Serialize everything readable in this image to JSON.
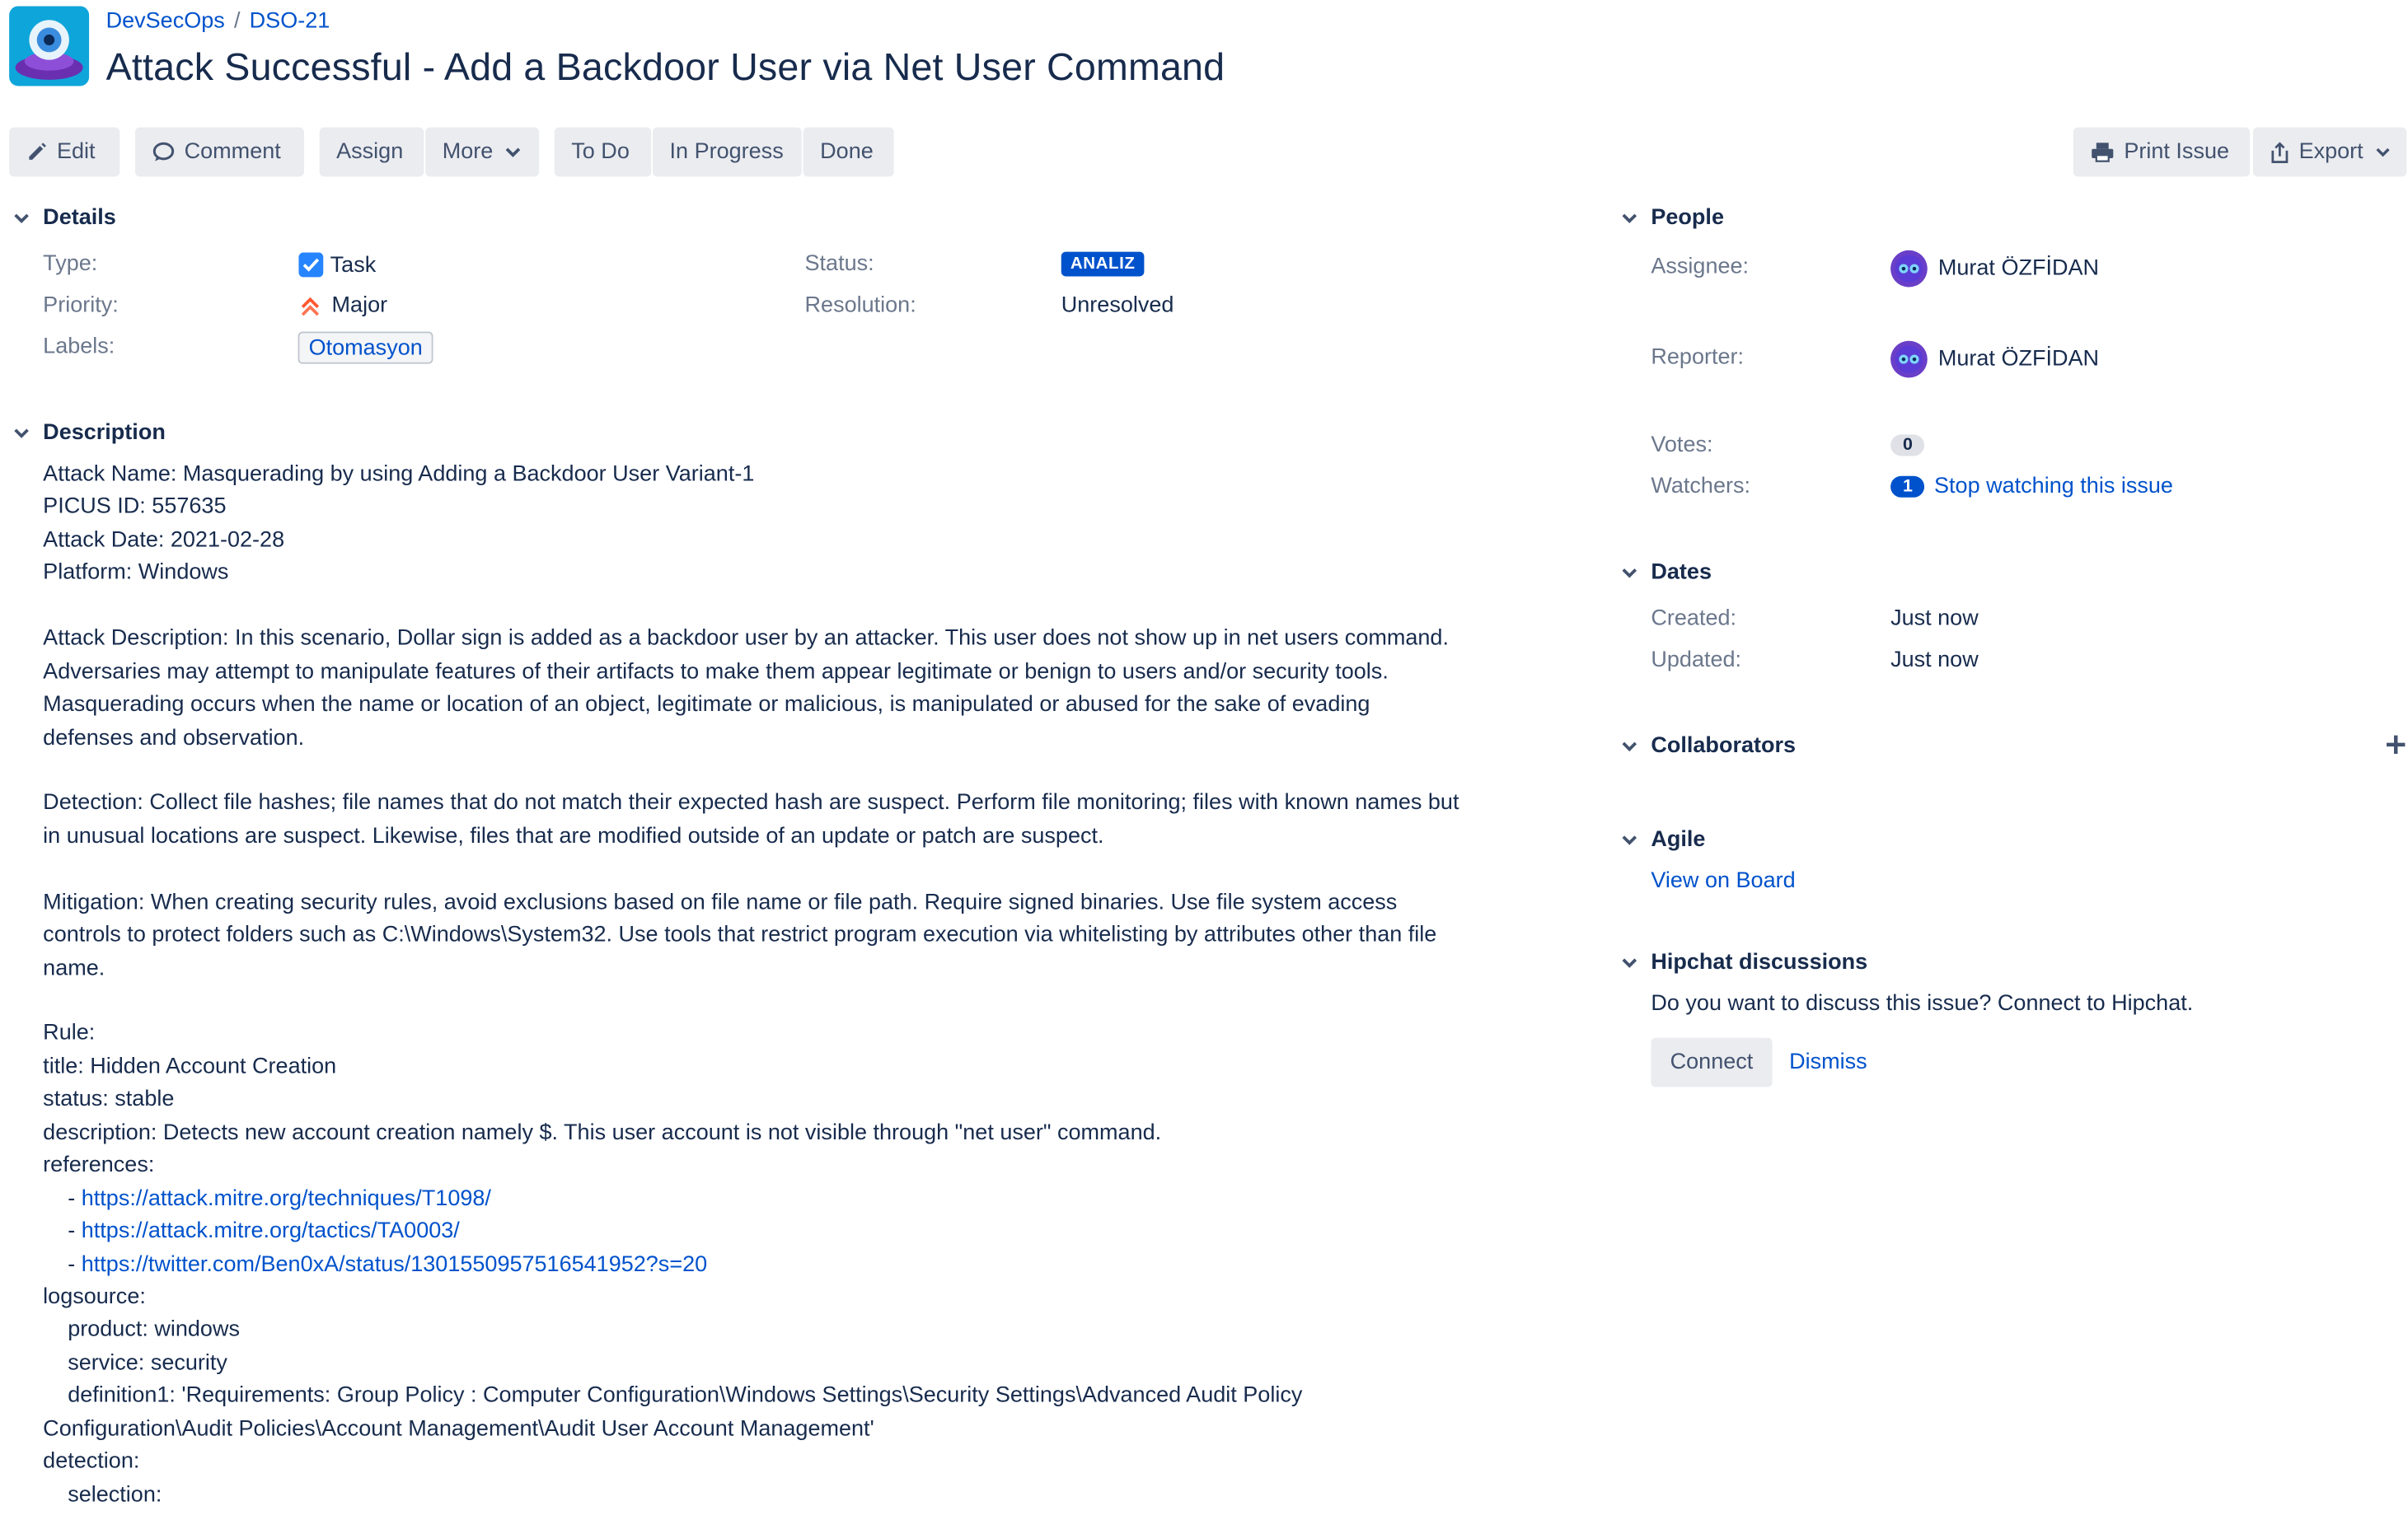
{
  "header": {
    "project": "DevSecOps",
    "separator": "/",
    "issue_key": "DSO-21",
    "title": "Attack Successful - Add a Backdoor User via Net User Command"
  },
  "toolbar": {
    "edit": "Edit",
    "comment": "Comment",
    "assign": "Assign",
    "more": "More",
    "todo": "To Do",
    "in_progress": "In Progress",
    "done": "Done",
    "print": "Print Issue",
    "export": "Export"
  },
  "details": {
    "heading": "Details",
    "type_label": "Type:",
    "type_value": "Task",
    "priority_label": "Priority:",
    "priority_value": "Major",
    "labels_label": "Labels:",
    "labels_value": "Otomasyon",
    "status_label": "Status:",
    "status_value": "ANALIZ",
    "resolution_label": "Resolution:",
    "resolution_value": "Unresolved"
  },
  "description": {
    "heading": "Description",
    "lines": [
      {
        "text": "Attack Name: Masquerading by using Adding a Backdoor User Variant-1"
      },
      {
        "text": "PICUS ID: 557635"
      },
      {
        "text": "Attack Date: 2021-02-28"
      },
      {
        "text": "Platform: Windows"
      },
      {
        "text": ""
      },
      {
        "text": "Attack Description: In this scenario, Dollar sign is added as a backdoor user by an attacker. This user does not show up in net users command."
      },
      {
        "text": "Adversaries may attempt to manipulate features of their artifacts to make them appear legitimate or benign to users and/or security tools."
      },
      {
        "text": "Masquerading occurs when the name or location of an object, legitimate or malicious, is manipulated or abused for the sake of evading"
      },
      {
        "text": "defenses and observation."
      },
      {
        "text": ""
      },
      {
        "text": "Detection: Collect file hashes; file names that do not match their expected hash are suspect. Perform file monitoring; files with known names but"
      },
      {
        "text": "in unusual locations are suspect. Likewise, files that are modified outside of an update or patch are suspect."
      },
      {
        "text": ""
      },
      {
        "text": "Mitigation: When creating security rules, avoid exclusions based on file name or file path. Require signed binaries. Use file system access"
      },
      {
        "text": "controls to protect folders such as C:\\Windows\\System32. Use tools that restrict program execution via whitelisting by attributes other than file"
      },
      {
        "text": "name."
      },
      {
        "text": ""
      },
      {
        "text": "Rule:"
      },
      {
        "text": "title: Hidden Account Creation"
      },
      {
        "text": "status: stable"
      },
      {
        "text": "description: Detects new account creation namely $. This user account is not visible through \"net user\" command."
      },
      {
        "text": "references:"
      },
      {
        "text": "    - ",
        "link": "https://attack.mitre.org/techniques/T1098/"
      },
      {
        "text": "    - ",
        "link": "https://attack.mitre.org/tactics/TA0003/"
      },
      {
        "text": "    - ",
        "link": "https://twitter.com/Ben0xA/status/1301550957516541952?s=20"
      },
      {
        "text": "logsource:"
      },
      {
        "text": "    product: windows"
      },
      {
        "text": "    service: security"
      },
      {
        "text": "    definition1: 'Requirements: Group Policy : Computer Configuration\\Windows Settings\\Security Settings\\Advanced Audit Policy"
      },
      {
        "text": "Configuration\\Audit Policies\\Account Management\\Audit User Account Management'"
      },
      {
        "text": "detection:"
      },
      {
        "text": "    selection:"
      }
    ]
  },
  "people": {
    "heading": "People",
    "assignee_label": "Assignee:",
    "assignee_name": "Murat ÖZFİDAN",
    "reporter_label": "Reporter:",
    "reporter_name": "Murat ÖZFİDAN",
    "votes_label": "Votes:",
    "votes_count": "0",
    "watchers_label": "Watchers:",
    "watchers_count": "1",
    "watch_link": "Stop watching this issue"
  },
  "dates": {
    "heading": "Dates",
    "created_label": "Created:",
    "created_value": "Just now",
    "updated_label": "Updated:",
    "updated_value": "Just now"
  },
  "collaborators": {
    "heading": "Collaborators"
  },
  "agile": {
    "heading": "Agile",
    "link": "View on Board"
  },
  "hipchat": {
    "heading": "Hipchat discussions",
    "text": "Do you want to discuss this issue? Connect to Hipchat.",
    "connect": "Connect",
    "dismiss": "Dismiss"
  },
  "colors": {
    "link": "#0052cc",
    "status": "#0052cc",
    "text": "#172b4d",
    "muted": "#6b778c",
    "button_bg": "#ebecf0"
  }
}
